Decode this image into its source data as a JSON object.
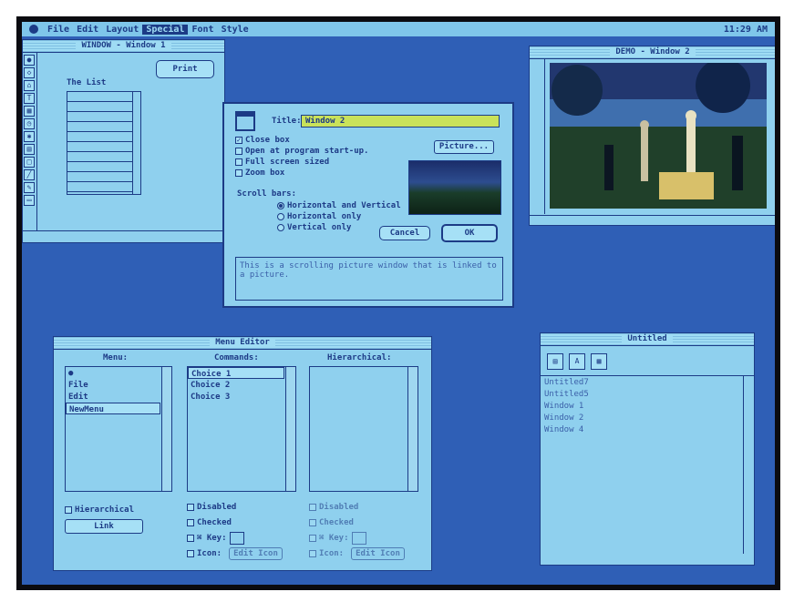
{
  "menubar": {
    "items": [
      "File",
      "Edit",
      "Layout",
      "Special",
      "Font",
      "Style"
    ],
    "active": "Special",
    "clock": "11:29 AM"
  },
  "window1": {
    "title": "WINDOW - Window 1",
    "print_label": "Print",
    "list_label": "The List",
    "tools": [
      "circle-tool-icon",
      "diamond-tool-icon",
      "home-tool-icon",
      "text-tool-icon",
      "grid-tool-icon",
      "clock-tool-icon",
      "gear-tool-icon",
      "window-tool-icon",
      "rect-tool-icon",
      "line-tool-icon",
      "pencil-tool-icon",
      "page-tool-icon"
    ]
  },
  "dialog": {
    "title_label": "Title:",
    "title_value": "Window 2",
    "options": [
      {
        "label": "Close box",
        "checked": true
      },
      {
        "label": "Open at program start-up.",
        "checked": false
      },
      {
        "label": "Full screen sized",
        "checked": false
      },
      {
        "label": "Zoom box",
        "checked": false
      }
    ],
    "picture_label": "Picture...",
    "scroll_label": "Scroll bars:",
    "scroll_options": [
      {
        "label": "Horizontal and Vertical",
        "selected": true
      },
      {
        "label": "Horizontal only",
        "selected": false
      },
      {
        "label": "Vertical only",
        "selected": false
      }
    ],
    "cancel_label": "Cancel",
    "ok_label": "OK",
    "description": "This is a scrolling picture window that is linked to a picture."
  },
  "window2": {
    "title": "DEMO - Window 2"
  },
  "menu_editor": {
    "title": "Menu Editor",
    "menu_header": "Menu:",
    "commands_header": "Commands:",
    "hierarchical_header": "Hierarchical:",
    "menu_items": [
      "●",
      "File",
      "Edit",
      "NewMenu"
    ],
    "selected_menu": "NewMenu",
    "command_items": [
      "Choice 1",
      "Choice 2",
      "Choice 3"
    ],
    "selected_command": "Choice 1",
    "hier_checkbox": "Hierarchical",
    "link_label": "Link",
    "cmd_options": [
      "Disabled",
      "Checked",
      "⌘ Key:",
      "Icon:"
    ],
    "edit_icon_label": "Edit Icon",
    "hier_options": [
      "Disabled",
      "Checked",
      "⌘ Key:",
      "Icon:"
    ],
    "hier_edit_icon_label": "Edit Icon"
  },
  "untitled": {
    "title": "Untitled",
    "files": [
      "Untitled7",
      "Untitled5",
      "Window 1",
      "Window 2",
      "Window 4"
    ]
  }
}
